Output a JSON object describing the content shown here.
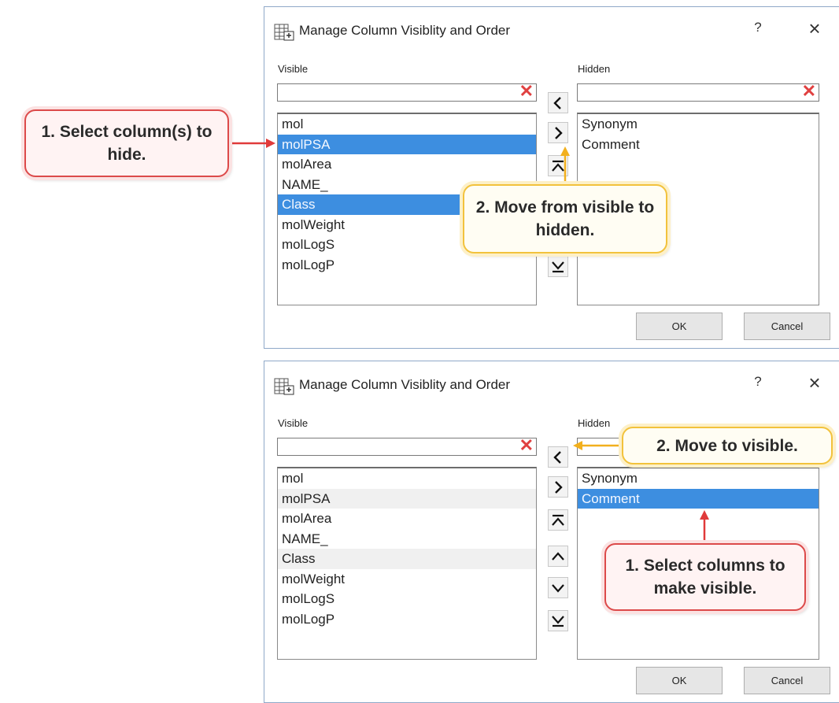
{
  "dialogs": [
    {
      "title": "Manage Column Visiblity and Order",
      "help": "?",
      "close": "×",
      "visible_label": "Visible",
      "hidden_label": "Hidden",
      "clear_glyph": "✕",
      "visible_items": [
        "mol",
        "molPSA",
        "molArea",
        "NAME_",
        "Class",
        "molWeight",
        "molLogS",
        "molLogP"
      ],
      "hidden_items": [
        "Synonym",
        "Comment"
      ],
      "ok": "OK",
      "cancel": "Cancel"
    },
    {
      "title": "Manage Column Visiblity and Order",
      "help": "?",
      "close": "×",
      "visible_label": "Visible",
      "hidden_label": "Hidden",
      "clear_glyph": "✕",
      "visible_items": [
        "mol",
        "molPSA",
        "molArea",
        "NAME_",
        "Class",
        "molWeight",
        "molLogS",
        "molLogP"
      ],
      "hidden_items": [
        "Synonym",
        "Comment"
      ],
      "ok": "OK",
      "cancel": "Cancel"
    }
  ],
  "callouts": {
    "select_hide": "1. Select column(s) to hide.",
    "move_hidden": "2. Move from visible to hidden.",
    "move_visible": "2. Move to visible.",
    "select_visible": "1. Select columns to make visible."
  },
  "colors": {
    "selection": "#3d8ee0",
    "red_arrow": "#e03a3a",
    "yellow_arrow": "#f2b01e"
  }
}
